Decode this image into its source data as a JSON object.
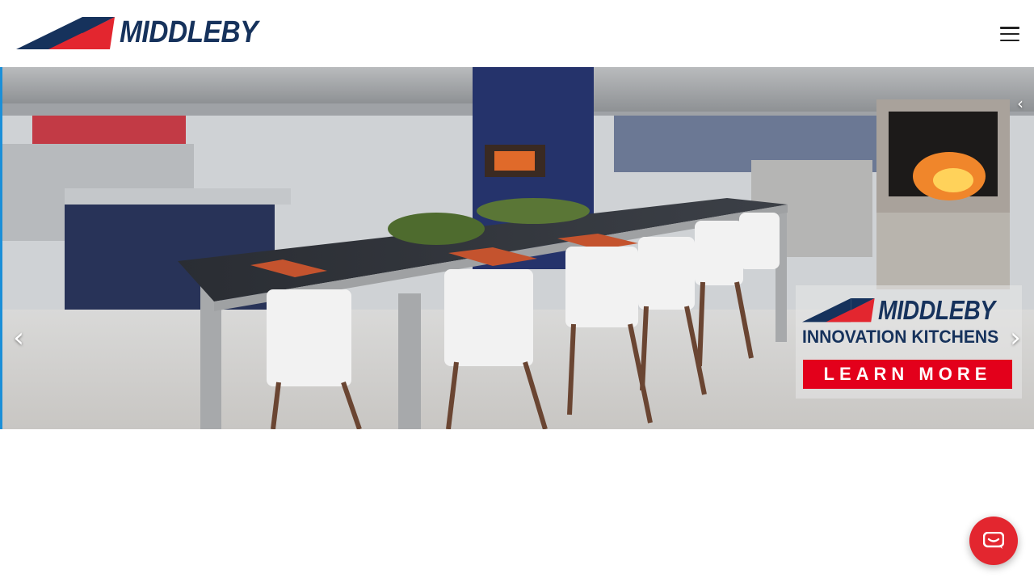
{
  "header": {
    "brand": "MIDDLEBY",
    "menu_icon": "hamburger-menu-icon"
  },
  "hero": {
    "banner": {
      "brand": "MIDDLEBY",
      "subtitle": "INNOVATION KITCHENS",
      "cta_label": "LEARN MORE"
    },
    "prev_icon": "chevron-left-icon",
    "next_icon": "chevron-right-icon"
  },
  "chat": {
    "icon": "chat-bubble-icon"
  },
  "colors": {
    "brand_navy": "#16325c",
    "brand_red": "#e3262f",
    "cta_red": "#e3001b"
  }
}
